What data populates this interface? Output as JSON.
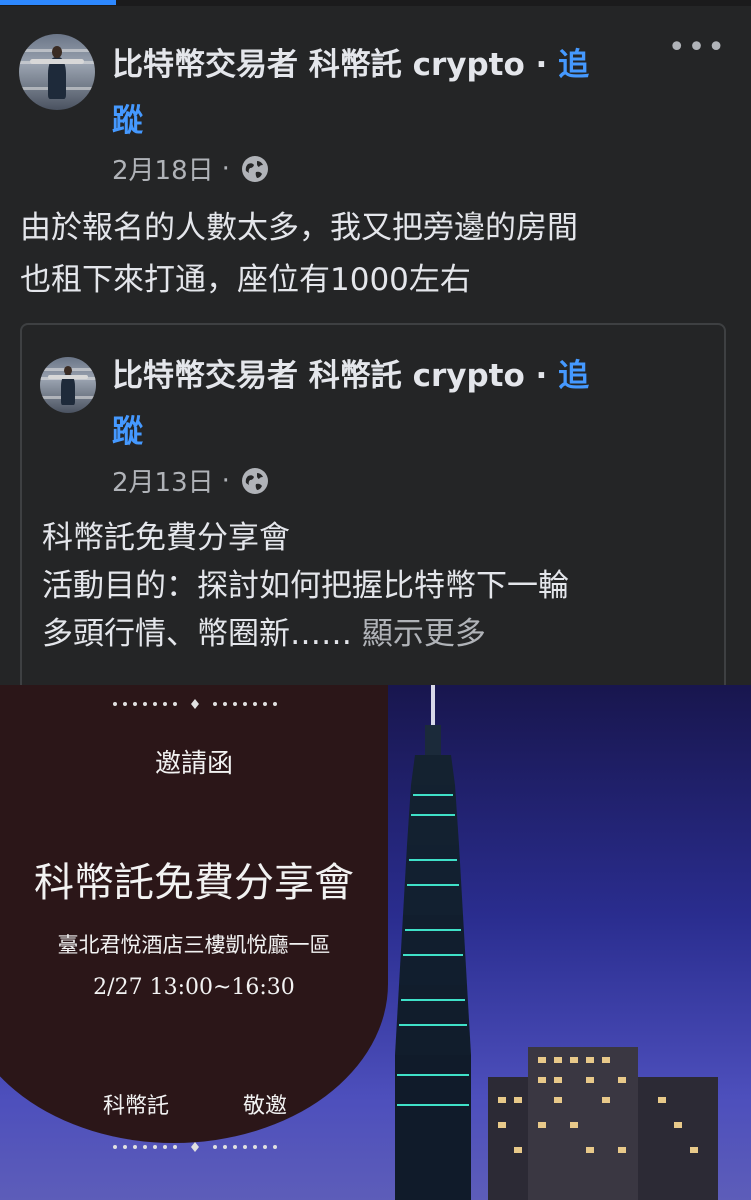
{
  "post": {
    "author": "比特幣交易者 科幣託 crypto",
    "separator": " · ",
    "follow_line1": "追",
    "follow_line2": "蹤",
    "date": "2月18日",
    "date_dot": " ·",
    "more": "•••",
    "text_line1": "由於報名的人數太多，我又把旁邊的房間",
    "text_line2": "也租下來打通，座位有1000左右"
  },
  "shared_post": {
    "author": "比特幣交易者 科幣託 crypto",
    "separator": " · ",
    "follow_line1": "追",
    "follow_line2": "蹤",
    "date": "2月13日",
    "date_dot": " ·",
    "text_line1": "科幣託免費分享會",
    "text_line2": "活動目的：探討如何把握比特幣下一輪",
    "text_line3": "多頭行情、幣圈新……",
    "see_more": " 顯示更多"
  },
  "invitation": {
    "heading": "邀請函",
    "title": "科幣託免費分享會",
    "venue": "臺北君悅酒店三樓凱悅廳一區",
    "time": "2/27 13:00~16:30",
    "host": "科幣託",
    "closing": "敬邀"
  },
  "colors": {
    "background": "#242526",
    "follow_link": "#4599ff",
    "invite_dark": "#2b1618",
    "sky": "#2a2d8f"
  },
  "icons": {
    "audience": "globe-icon",
    "more": "more-options-icon"
  }
}
